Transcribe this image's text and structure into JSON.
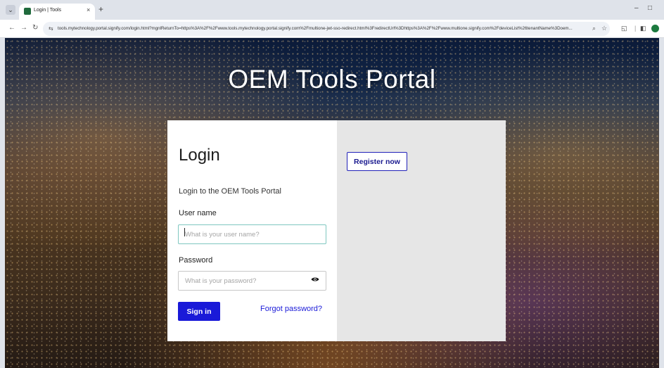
{
  "browser": {
    "tab_title": "Login | Tools",
    "tab_close": "×",
    "new_tab": "+",
    "url": "tools.mytechnology.portal.signify.com/login.html?mgnlReturnTo=https%3A%2F%2Fwww.tools.mytechnology.portal.signify.com%2Fmultione-jwt-sso-redirect.html%3FredirectUrl%3Dhttps%3A%2F%2Fwww.multione.signify.com%2FdeviceList%26tenantName%3Doem..."
  },
  "page": {
    "portal_title": "OEM Tools Portal"
  },
  "login": {
    "heading": "Login",
    "subtitle": "Login to the OEM Tools Portal",
    "username_label": "User name",
    "username_placeholder": "What is your user name?",
    "password_label": "Password",
    "password_placeholder": "What is your password?",
    "signin_label": "Sign in",
    "forgot_label": "Forgot password?"
  },
  "register": {
    "button_label": "Register now"
  },
  "colors": {
    "accent": "#1a1ad8",
    "panel_grey": "#e6e6e6"
  }
}
